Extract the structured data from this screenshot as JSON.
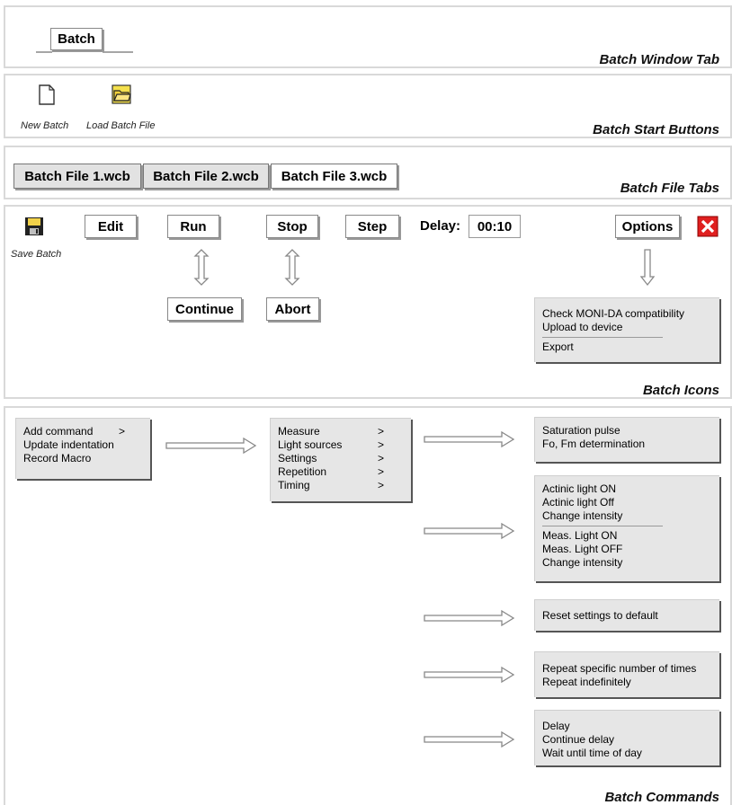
{
  "sections": {
    "window_tab": "Batch Window Tab",
    "start_buttons": "Batch Start Buttons",
    "file_tabs": "Batch File Tabs",
    "icons": "Batch Icons",
    "commands": "Batch Commands"
  },
  "window_tab": {
    "label": "Batch"
  },
  "start_buttons": {
    "new_batch": {
      "label": "New Batch",
      "icon": "new-file-icon"
    },
    "load_batch": {
      "label": "Load Batch File",
      "icon": "open-folder-icon"
    }
  },
  "file_tabs": [
    "Batch File 1.wcb",
    "Batch File 2.wcb",
    "Batch File 3.wcb"
  ],
  "icons": {
    "save": {
      "label": "Save Batch",
      "icon": "floppy-disk-icon"
    },
    "edit": "Edit",
    "run": "Run",
    "stop": "Stop",
    "step": "Step",
    "delay_label": "Delay:",
    "delay_value": "00:10",
    "options": "Options",
    "close_icon": "close-x-icon",
    "continue": "Continue",
    "abort": "Abort",
    "options_menu": {
      "group1": [
        "Check MONI-DA compatibility",
        "Upload to device"
      ],
      "group2": [
        "Export"
      ]
    }
  },
  "commands": {
    "main_menu": [
      {
        "label": "Add command",
        "sub": ">"
      },
      {
        "label": "Update indentation",
        "sub": ""
      },
      {
        "label": "Record Macro",
        "sub": ""
      }
    ],
    "sub_menu": [
      {
        "label": "Measure",
        "sub": ">"
      },
      {
        "label": "Light sources",
        "sub": ">"
      },
      {
        "label": "Settings",
        "sub": ">"
      },
      {
        "label": "Repetition",
        "sub": ">"
      },
      {
        "label": "Timing",
        "sub": ">"
      }
    ],
    "measure_menu": [
      "Saturation pulse",
      "Fo, Fm determination"
    ],
    "light_menu": {
      "group1": [
        "Actinic light ON",
        "Actinic light Off",
        "Change intensity"
      ],
      "group2": [
        "Meas. Light ON",
        "Meas. Light OFF",
        "Change intensity"
      ]
    },
    "settings_menu": [
      "Reset settings to default"
    ],
    "repetition_menu": [
      "Repeat specific number of times",
      "Repeat indefinitely"
    ],
    "timing_menu": [
      "Delay",
      "Continue delay",
      "Wait until time of day"
    ]
  },
  "colors": {
    "close": "#e02020",
    "menu_bg": "#e6e6e6",
    "section_border": "#d9d9d9"
  }
}
